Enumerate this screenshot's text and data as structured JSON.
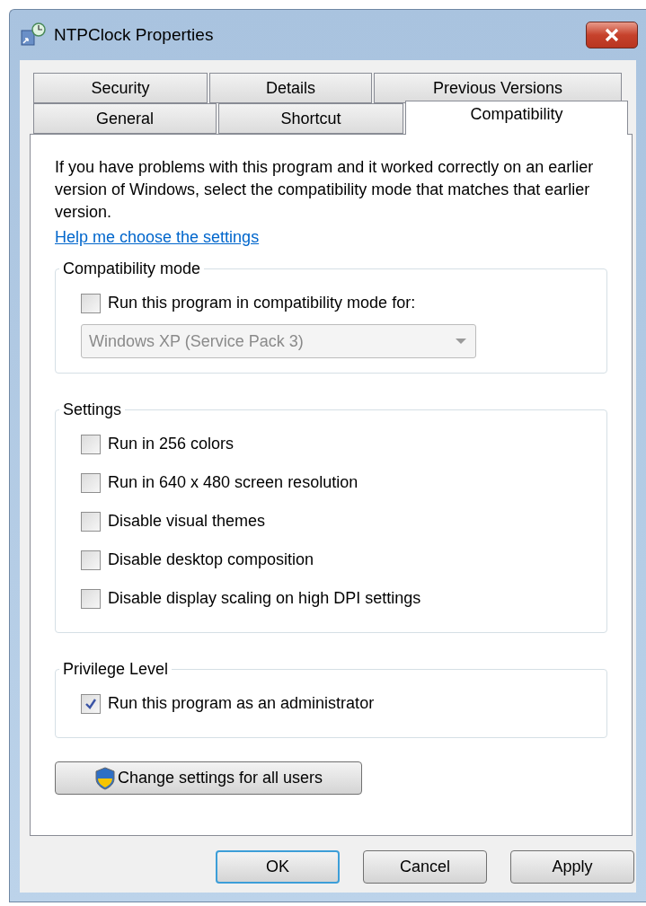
{
  "window": {
    "title": "NTPClock Properties"
  },
  "tab_rows": [
    [
      {
        "label": "Security",
        "selected": false
      },
      {
        "label": "Details",
        "selected": false
      },
      {
        "label": "Previous Versions",
        "selected": false
      }
    ],
    [
      {
        "label": "General",
        "selected": false
      },
      {
        "label": "Shortcut",
        "selected": false
      },
      {
        "label": "Compatibility",
        "selected": true
      }
    ]
  ],
  "intro": "If you have problems with this program and it worked correctly on an earlier version of Windows, select the compatibility mode that matches that earlier version.",
  "help_link": "Help me choose the settings",
  "groups": [
    {
      "title": "Compatibility mode",
      "options": [
        {
          "label": "Run this program in compatibility mode for:",
          "checked": false
        }
      ],
      "dropdown": {
        "value": "Windows XP (Service Pack 3)",
        "disabled": true
      }
    },
    {
      "title": "Settings",
      "options": [
        {
          "label": "Run in 256 colors",
          "checked": false
        },
        {
          "label": "Run in 640 x 480 screen resolution",
          "checked": false
        },
        {
          "label": "Disable visual themes",
          "checked": false
        },
        {
          "label": "Disable desktop composition",
          "checked": false
        },
        {
          "label": "Disable display scaling on high DPI settings",
          "checked": false
        }
      ]
    },
    {
      "title": "Privilege Level",
      "options": [
        {
          "label": "Run this program as an administrator",
          "checked": true
        }
      ]
    }
  ],
  "change_button": "Change settings for all users",
  "buttons": [
    {
      "label": "OK",
      "default": true
    },
    {
      "label": "Cancel",
      "default": false
    },
    {
      "label": "Apply",
      "default": false
    }
  ]
}
